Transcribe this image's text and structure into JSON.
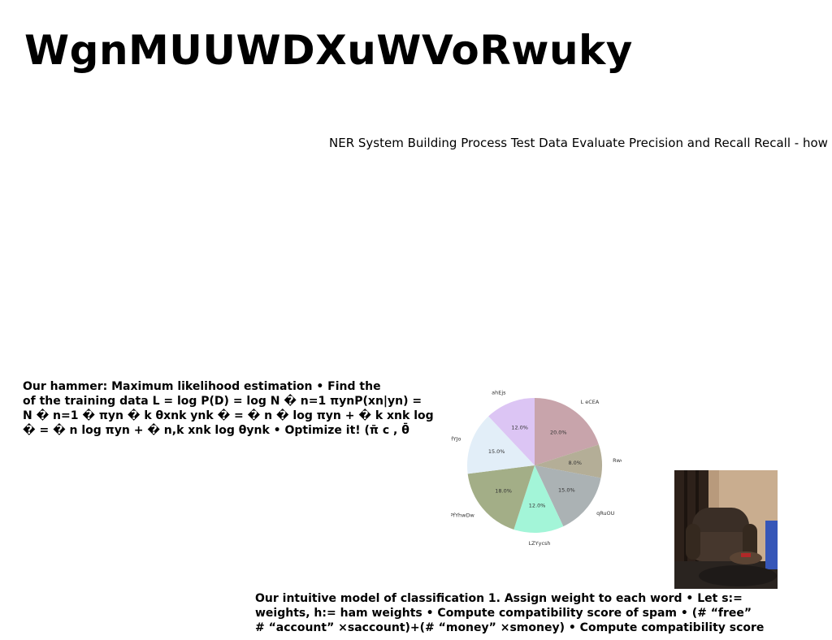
{
  "page": {
    "title": "WgnMUUWDXuWVoRwuky",
    "subtitle": "NER System Building Process Test Data Evaluate Precision and Recall Recall - how"
  },
  "paragraphs": [
    {
      "lines": [
        "Our hammer: Maximum likelihood estimation • Find the",
        "of the training data L = log P(D) = log N � n=1 πynP(xn|yn) =",
        "N � n=1 � πyn � k θxnk ynk � = � n � log πyn + � k xnk log",
        "� = � n log πyn + � n,k xnk log θynk • Optimize it! (π̄ c , θ̄"
      ]
    },
    {
      "lines": [
        "Our intuitive model of classification 1. Assign weight to each word • Let s:=",
        "weights, h:= ham weights • Compute compatibility score of spam • (# “free”",
        "# “account” ×saccount)+(# “money” ×smoney) • Compute compatibility score"
      ]
    }
  ],
  "chart_data": {
    "type": "pie",
    "categories": [
      "L eCEA",
      "RweGZl",
      "qRuOU",
      "LZYycsh",
      "YpwPfYhwDw",
      "pZdfYJo",
      "ahEjs"
    ],
    "values": [
      20.0,
      8.0,
      15.0,
      12.0,
      18.0,
      15.0,
      12.0
    ],
    "value_labels": [
      "20.0%",
      "8.0%",
      "15.0%",
      "12.0%",
      "18.0%",
      "15.0%",
      "12.0%"
    ],
    "colors": [
      "#c8a4ab",
      "#b4ae97",
      "#abb2b4",
      "#a3f5d8",
      "#a3ae87",
      "#e2eef8",
      "#dcc5f4"
    ],
    "start_angle": "top",
    "direction": "clockwise"
  },
  "photo": {
    "subject": "armchair-photo",
    "colors": {
      "wall": "#b89a7c",
      "curtain": "#2d211a",
      "chair": "#3a2e26",
      "floor": "#2a2420",
      "table": "#5a4434",
      "book": "#b02828"
    }
  }
}
